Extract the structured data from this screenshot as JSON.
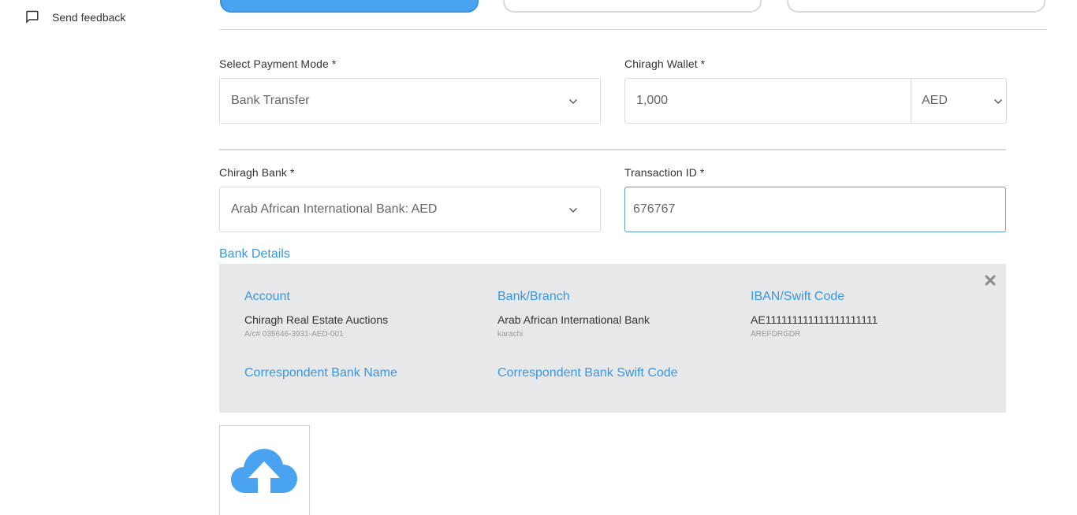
{
  "sidebar": {
    "feedback_label": "Send feedback",
    "feedback_icon": "comment-icon"
  },
  "form": {
    "payment_mode": {
      "label": "Select Payment Mode *",
      "value": "Bank Transfer"
    },
    "wallet": {
      "label": "Chiragh Wallet *",
      "value": "1,000",
      "currency": "AED"
    },
    "bank": {
      "label": "Chiragh Bank *",
      "value": "Arab African International Bank: AED"
    },
    "transaction": {
      "label": "Transaction ID *",
      "value": "676767"
    }
  },
  "bank_details": {
    "title": "Bank Details",
    "account": {
      "heading": "Account",
      "name": "Chiragh Real Estate Auctions",
      "number": "A/c# 035646-3931-AED-001"
    },
    "branch": {
      "heading": "Bank/Branch",
      "name": "Arab African International Bank",
      "location": "karachi"
    },
    "iban": {
      "heading": "IBAN/Swift Code",
      "iban": "AE111111111111111111111",
      "swift": "AREFDRGDR"
    },
    "correspondent_name_heading": "Correspondent Bank Name",
    "correspondent_swift_heading": "Correspondent Bank Swift Code"
  },
  "colors": {
    "accent": "#3a96e0",
    "tab_active": "#4aa3f0",
    "panel_bg": "#e7e8ea"
  }
}
